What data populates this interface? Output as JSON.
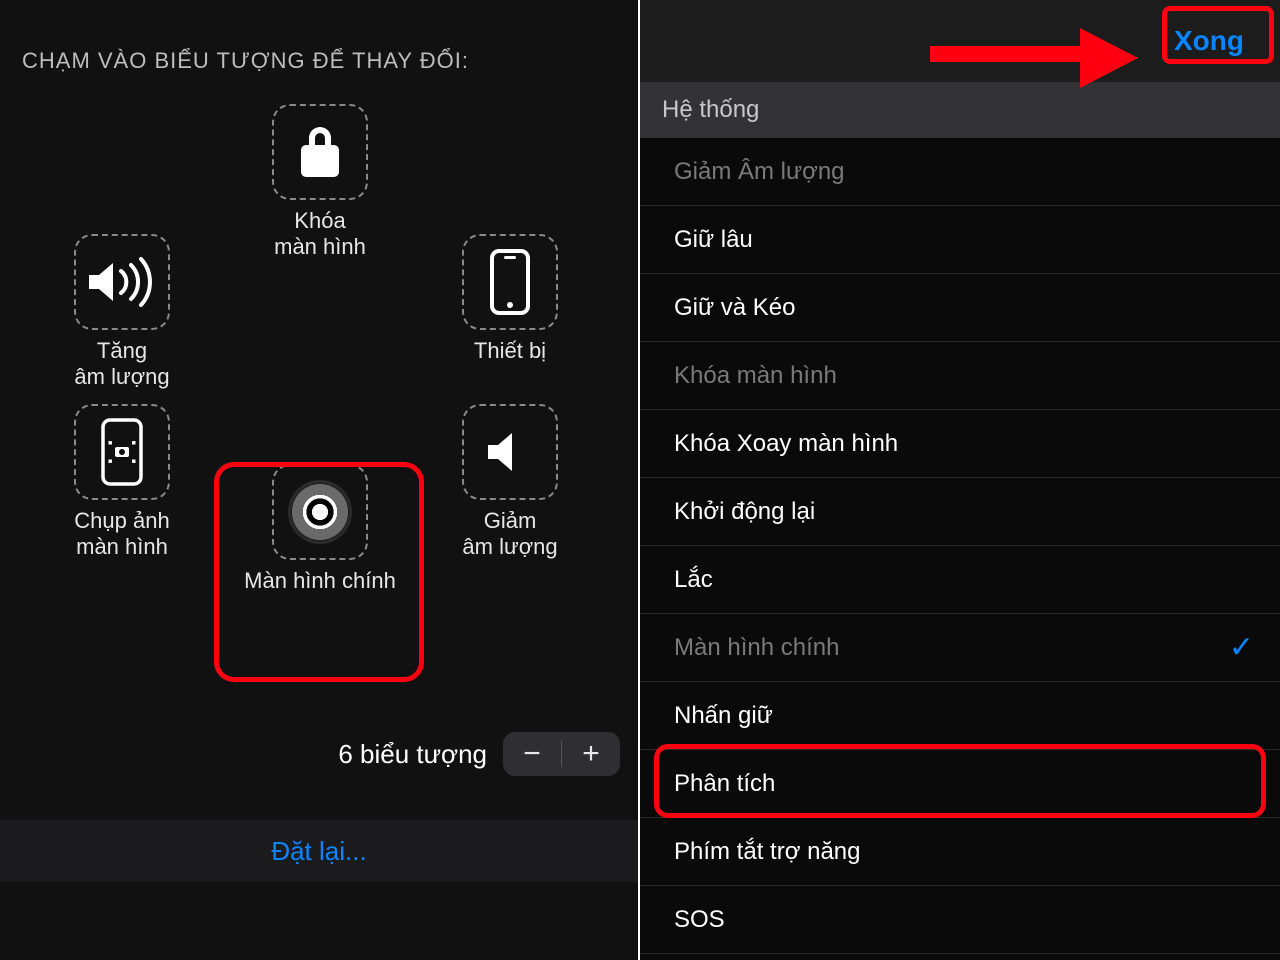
{
  "left": {
    "instruction": "CHẠM VÀO BIỂU TƯỢNG ĐỂ THAY ĐỔI:",
    "cells": {
      "top": {
        "label": "Khóa\nmàn hình"
      },
      "left": {
        "label": "Tăng\nâm lượng"
      },
      "right": {
        "label": "Thiết bị"
      },
      "bl": {
        "label": "Chụp ảnh\nmàn hình"
      },
      "br": {
        "label": "Giảm\nâm lượng"
      },
      "bottom": {
        "label": "Màn hình chính"
      }
    },
    "counter_label": "6 biểu tượng",
    "reset": "Đặt lại..."
  },
  "right": {
    "done": "Xong",
    "section": "Hệ thống",
    "items": [
      {
        "label": "Giảm Âm lượng",
        "dim": true,
        "checked": false
      },
      {
        "label": "Giữ lâu",
        "dim": false,
        "checked": false
      },
      {
        "label": "Giữ và Kéo",
        "dim": false,
        "checked": false
      },
      {
        "label": "Khóa màn hình",
        "dim": true,
        "checked": false
      },
      {
        "label": "Khóa Xoay màn hình",
        "dim": false,
        "checked": false
      },
      {
        "label": "Khởi động lại",
        "dim": false,
        "checked": false
      },
      {
        "label": "Lắc",
        "dim": false,
        "checked": false
      },
      {
        "label": "Màn hình chính",
        "dim": true,
        "checked": true
      },
      {
        "label": "Nhấn giữ",
        "dim": false,
        "checked": false
      },
      {
        "label": "Phân tích",
        "dim": false,
        "checked": false
      },
      {
        "label": "Phím tắt trợ năng",
        "dim": false,
        "checked": false
      },
      {
        "label": "SOS",
        "dim": false,
        "checked": false
      }
    ]
  }
}
